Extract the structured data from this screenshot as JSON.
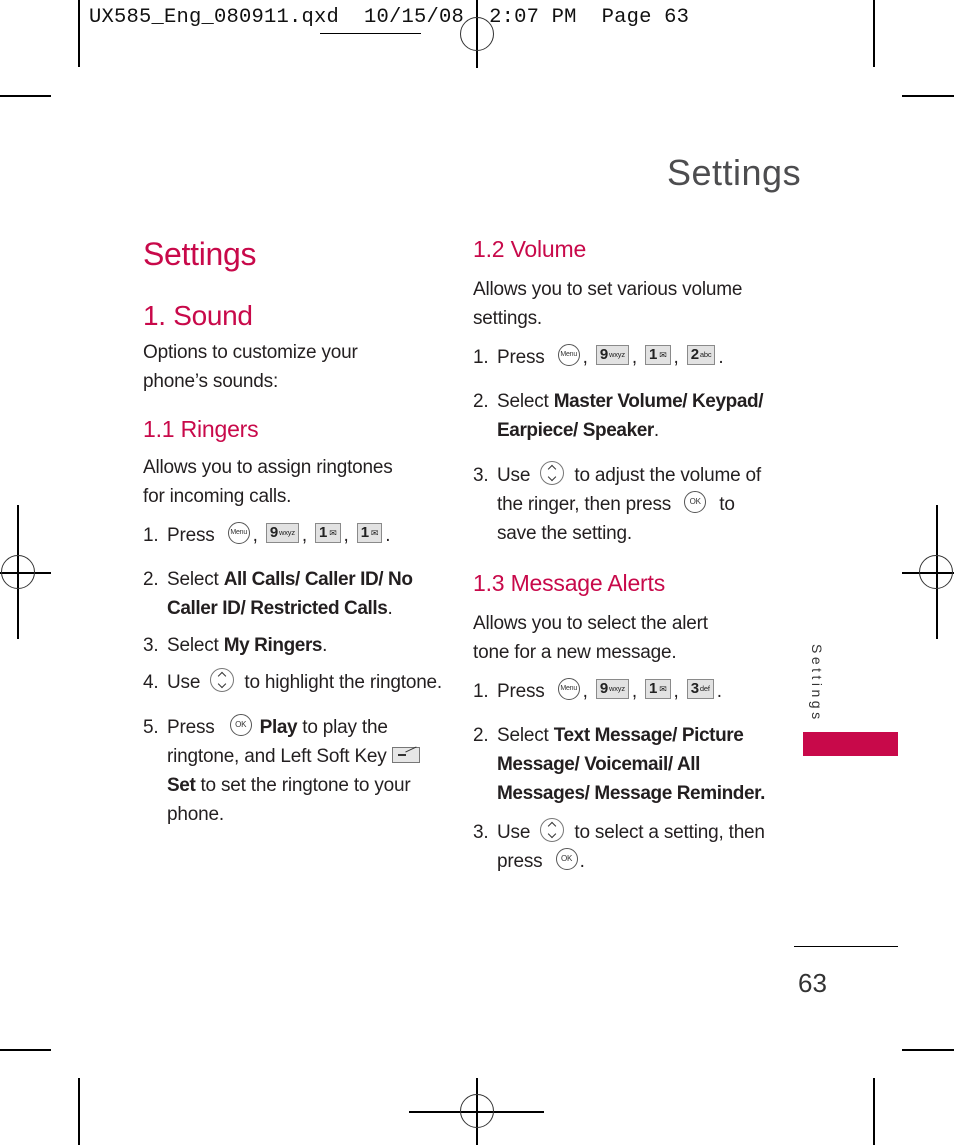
{
  "slug": "UX585_Eng_080911.qxd  10/15/08  2:07 PM  Page 63",
  "running_title": "Settings",
  "page_heading": "Settings",
  "section": {
    "number_title": "1. Sound",
    "intro": "Options to customize your phone’s sounds:"
  },
  "ringers": {
    "heading": "1.1 Ringers",
    "description": "Allows you to assign ringtones for incoming calls.",
    "steps": [
      {
        "num": "1.",
        "pre": "Press",
        "keys": [
          {
            "type": "circle",
            "label": "Menu"
          },
          {
            "type": "box",
            "main": "9",
            "sub": "wxyz"
          },
          {
            "type": "box",
            "main": "1",
            "sub": "voicemail"
          },
          {
            "type": "box",
            "main": "1",
            "sub": "voicemail"
          }
        ]
      },
      {
        "num": "2.",
        "pre": "Select ",
        "bold": "All Calls/ Caller ID/ No Caller ID/ Restricted Calls",
        "post": "."
      },
      {
        "num": "3.",
        "pre": "Select ",
        "bold": "My Ringers",
        "post": "."
      },
      {
        "num": "4.",
        "pre": "Use",
        "key": "navigation",
        "post": "to highlight the ringtone."
      },
      {
        "num": "5.",
        "pre": "Press",
        "key": "OK",
        "bold": "Play",
        "mid": " to play the ringtone, and Left Soft Key",
        "bold2": "Set",
        "post": " to set the ringtone to your phone."
      }
    ]
  },
  "volume": {
    "heading": "1.2 Volume",
    "description": "Allows you to set various volume settings.",
    "steps": [
      {
        "num": "1.",
        "pre": "Press",
        "keys": [
          {
            "type": "circle",
            "label": "Menu"
          },
          {
            "type": "box",
            "main": "9",
            "sub": "wxyz"
          },
          {
            "type": "box",
            "main": "1",
            "sub": "voicemail"
          },
          {
            "type": "box",
            "main": "2",
            "sub": "abc"
          }
        ]
      },
      {
        "num": "2.",
        "pre": "Select ",
        "bold": "Master Volume/ Keypad/ Earpiece/ Speaker",
        "post": "."
      },
      {
        "num": "3.",
        "pre": "Use",
        "key": "navigation",
        "mid": "to adjust the volume of the ringer, then press",
        "key2": "OK",
        "post": "to save the setting."
      }
    ]
  },
  "alerts": {
    "heading": "1.3 Message Alerts",
    "description": "Allows you to select the alert tone for a new message.",
    "steps": [
      {
        "num": "1.",
        "pre": "Press",
        "keys": [
          {
            "type": "circle",
            "label": "Menu"
          },
          {
            "type": "box",
            "main": "9",
            "sub": "wxyz"
          },
          {
            "type": "box",
            "main": "1",
            "sub": "voicemail"
          },
          {
            "type": "box",
            "main": "3",
            "sub": "def"
          }
        ]
      },
      {
        "num": "2.",
        "pre": "Select ",
        "bold": "Text Message/ Picture Message/ Voicemail/ All Messages/ Message Reminder.",
        "post": ""
      },
      {
        "num": "3.",
        "pre": "Use",
        "key": "navigation",
        "mid": "to select a setting, then press",
        "key2": "OK",
        "post": "."
      }
    ]
  },
  "side_tab": {
    "label": "Settings",
    "color": "#c8094a"
  },
  "page_number": "63",
  "colors": {
    "accent": "#c8094a",
    "text": "#231f20"
  }
}
